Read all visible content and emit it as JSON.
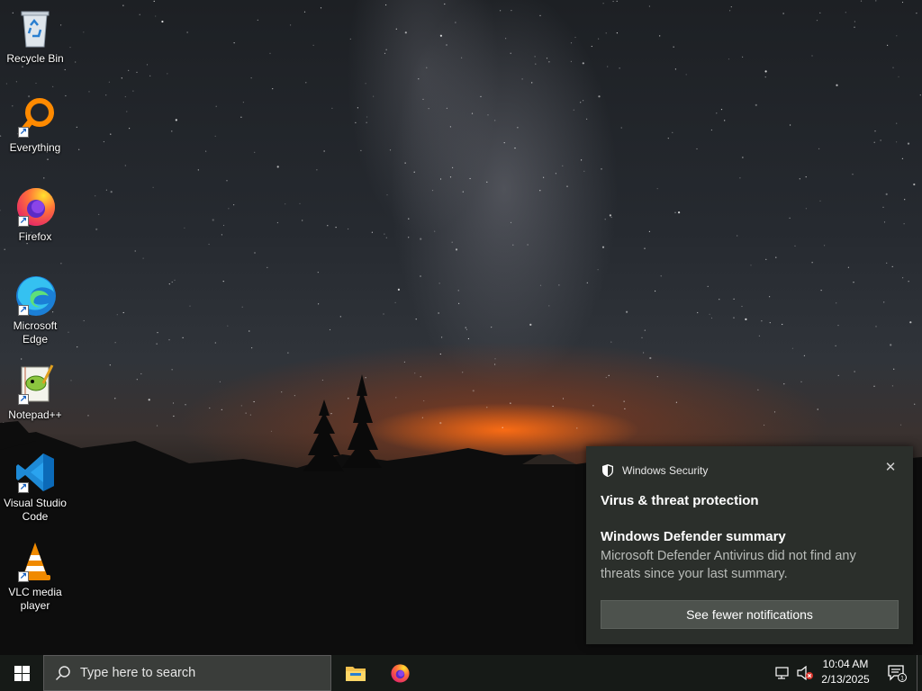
{
  "desktop_icons": [
    {
      "label": "Recycle Bin",
      "icon": "recycle-bin-icon",
      "shortcut": false
    },
    {
      "label": "Everything",
      "icon": "everything-search-icon",
      "shortcut": true
    },
    {
      "label": "Firefox",
      "icon": "firefox-icon",
      "shortcut": true
    },
    {
      "label": "Microsoft Edge",
      "icon": "edge-icon",
      "shortcut": true
    },
    {
      "label": "Notepad++",
      "icon": "notepad-plus-plus-icon",
      "shortcut": true
    },
    {
      "label": "Visual Studio Code",
      "icon": "vscode-icon",
      "shortcut": true
    },
    {
      "label": "VLC media player",
      "icon": "vlc-icon",
      "shortcut": true
    }
  ],
  "notification": {
    "app_name": "Windows Security",
    "headline": "Virus & threat protection",
    "summary_title": "Windows Defender summary",
    "summary_body": "Microsoft Defender Antivirus did not find any threats since your last summary.",
    "action_label": "See fewer notifications",
    "close_glyph": "✕"
  },
  "taskbar": {
    "search_placeholder": "Type here to search",
    "pinned": [
      "file-explorer-icon",
      "firefox-icon"
    ],
    "clock_time": "10:04 AM",
    "clock_date": "2/13/2025",
    "notification_count": "1"
  },
  "colors": {
    "taskbar_bg": "#161a17",
    "toast_bg": "#2b2f2b",
    "toast_button_bg": "#4d524d"
  }
}
